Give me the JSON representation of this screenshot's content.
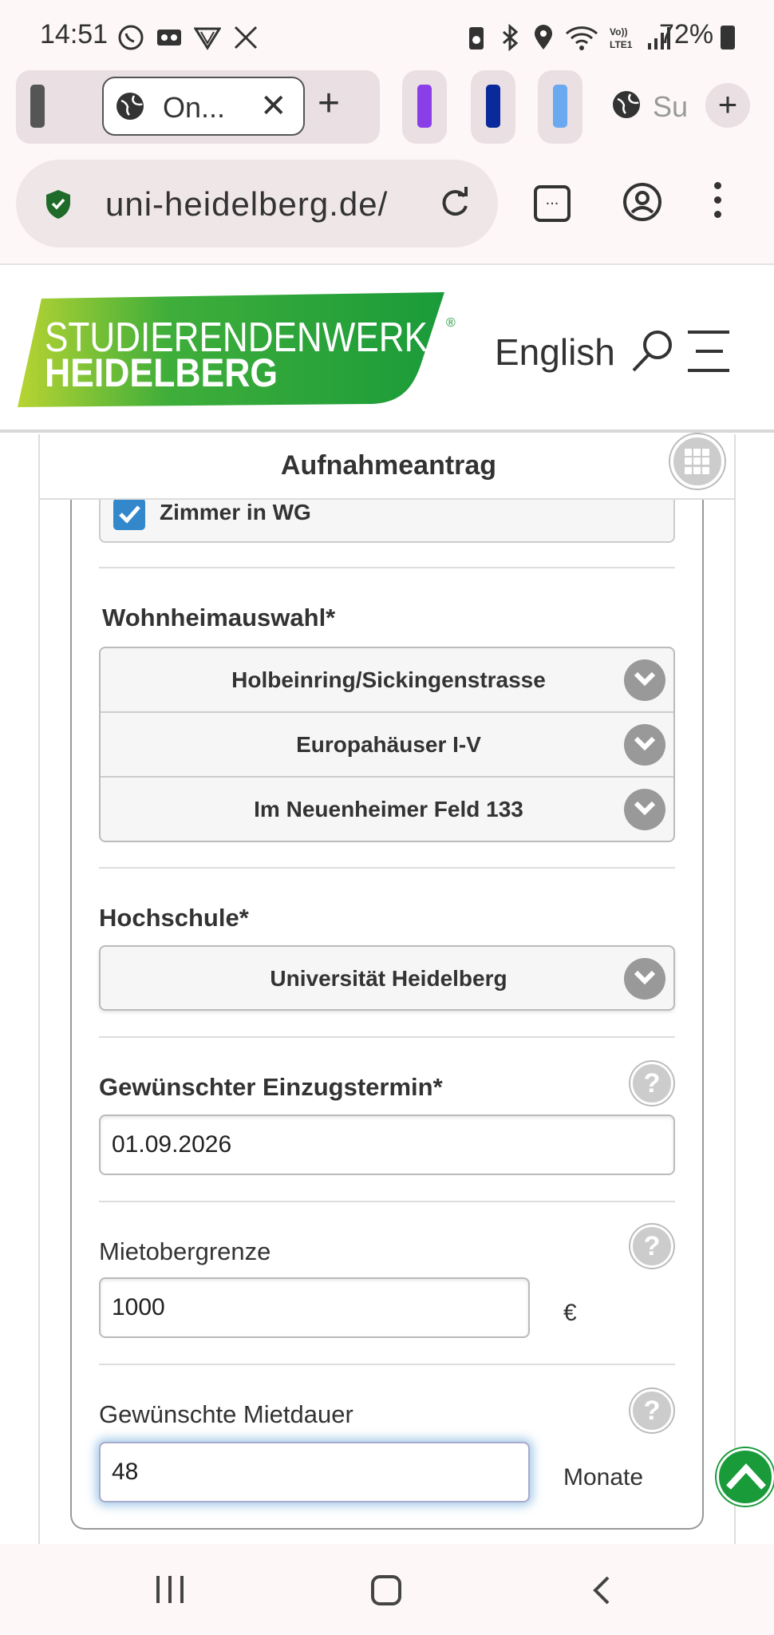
{
  "status_bar": {
    "time": "14:51",
    "battery_percent": "72%",
    "icons_left": [
      "viber-icon",
      "voicemail-icon",
      "vpn-icon",
      "missed-call-icon"
    ],
    "icons_right": [
      "battery-saver-icon",
      "bluetooth-icon",
      "location-icon",
      "wifi-icon",
      "volte-icon",
      "signal-icon"
    ]
  },
  "browser": {
    "active_tab_label": "On...",
    "second_tab_label": "Su",
    "url": "uni-heidelberg.de/",
    "tab_group_colors": [
      "#555555",
      "#8a3ee8",
      "#0a2a9c",
      "#6aa9f0"
    ],
    "tabs_button_label": "..."
  },
  "site": {
    "logo_line1": "STUDIERENDENWERK",
    "logo_line2": "HEIDELBERG",
    "logo_registered": "®",
    "language_link": "English",
    "brand_color": "#1a9b3a"
  },
  "form": {
    "title": "Aufnahmeantrag",
    "room_type_checkbox": {
      "label": "Zimmer in WG",
      "checked": true
    },
    "dorm_label": "Wohnheimauswahl*",
    "dorm_options": [
      "Holbeinring/Sickingenstrasse",
      "Europahäuser I-V",
      "Im Neuenheimer Feld 133"
    ],
    "university_label": "Hochschule*",
    "university_value": "Universität Heidelberg",
    "move_in_label": "Gewünschter Einzugstermin*",
    "move_in_value": "01.09.2026",
    "rent_limit_label": "Mietobergrenze",
    "rent_limit_value": "1000",
    "rent_limit_unit": "€",
    "duration_label": "Gewünschte Mietdauer",
    "duration_value": "48",
    "duration_unit": "Monate",
    "help_glyph": "?"
  }
}
